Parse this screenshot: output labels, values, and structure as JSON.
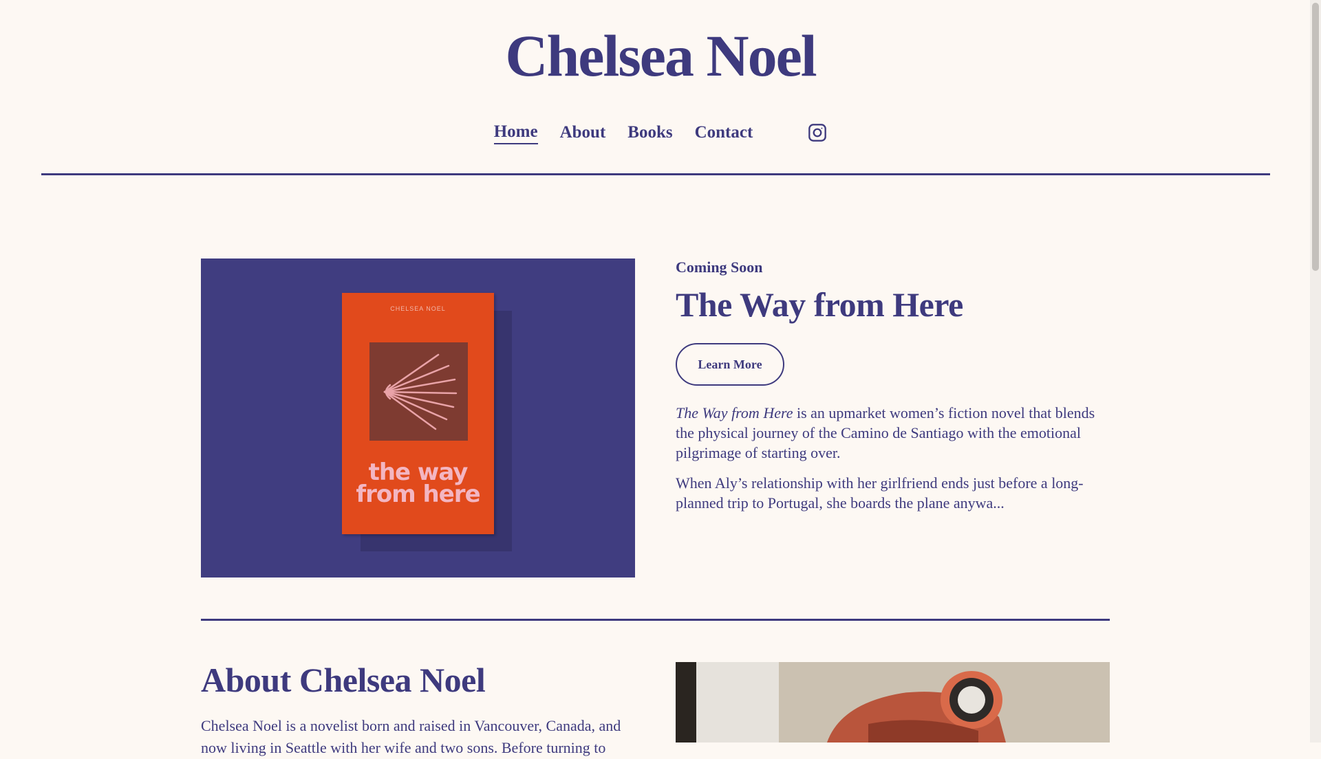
{
  "site": {
    "title": "Chelsea Noel"
  },
  "nav": {
    "items": [
      {
        "label": "Home",
        "active": true
      },
      {
        "label": "About",
        "active": false
      },
      {
        "label": "Books",
        "active": false
      },
      {
        "label": "Contact",
        "active": false
      }
    ],
    "social_icon": "instagram-icon"
  },
  "featured_book": {
    "eyebrow": "Coming Soon",
    "title": "The Way from Here",
    "button_label": "Learn More",
    "description_italic": "The Way from Here",
    "description_rest": " is an upmarket women’s fiction novel that blends the physical journey of the Camino de Santiago with the emotional pilgrimage of starting over.",
    "description_2": "When Aly’s relationship with her girlfriend ends just before a long-planned trip to Portugal, she boards the plane anywa...",
    "cover": {
      "author": "CHELSEA NOEL",
      "title": "the way from here"
    }
  },
  "about": {
    "heading": "About Chelsea Noel",
    "text": "Chelsea Noel is a novelist born and raised in Vancouver, Canada, and now living in Seattle with her wife and two sons. Before turning to"
  },
  "colors": {
    "background": "#fdf8f3",
    "accent": "#3e3a7e",
    "cover_orange": "#e14a1c",
    "panel": "#403d80"
  }
}
